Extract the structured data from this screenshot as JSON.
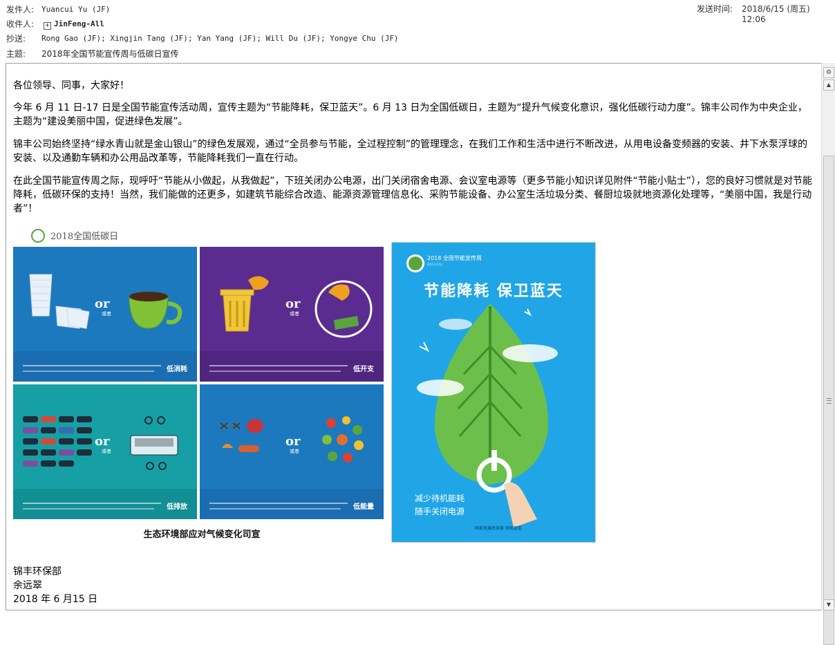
{
  "header": {
    "from_label": "发件人:",
    "from_value": "Yuancui Yu (JF)",
    "to_label": "收件人:",
    "to_value": "JinFeng-All",
    "to_icon": "group-expand-icon",
    "cc_label": "抄送:",
    "cc_value": "Rong Gao (JF); Xingjin Tang (JF); Yan Yang (JF); Will Du (JF); Yongye Chu (JF)",
    "subject_label": "主题:",
    "subject_value": "2018年全国节能宣传周与低碳日宣传",
    "sent_label": "发送时间:",
    "sent_value": "2018/6/15 (周五) 12:06"
  },
  "body": {
    "greeting": "各位领导、同事，大家好！",
    "p1": "今年 6 月 11 日-17 日是全国节能宣传活动周，宣传主题为“节能降耗，保卫蓝天”。6 月 13 日为全国低碳日，主题为“提升气候变化意识，强化低碳行动力度”。锦丰公司作为中央企业，主题为“建设美丽中国，促进绿色发展”。",
    "p2": "锦丰公司始终坚持“绿水青山就是金山银山”的绿色发展观，通过“全员参与节能，全过程控制”的管理理念，在我们工作和生活中进行不断改进，从用电设备变频器的安装、井下水泵浮球的安装、以及通勤车辆和办公用品改革等，节能降耗我们一直在行动。",
    "p3": "在此全国节能宣传周之际，现呼吁“节能从小做起，从我做起”，下班关闭办公电源，出门关闭宿舍电源、会议室电源等（更多节能小知识详见附件“节能小贴士”），您的良好习惯就是对节能降耗，低碳环保的支持！当然，我们能做的还更多，如建筑节能综合改造、能源资源管理信息化、采购节能设备、办公室生活垃圾分类、餐厨垃圾就地资源化处理等，“美丽中国，我是行动者”！"
  },
  "left_image": {
    "header_title": "2018全国低碳日",
    "cells": [
      {
        "or": "or",
        "huozhe": "或者",
        "tag": "低消耗",
        "bg": "#1d79be",
        "strip": "#1a6db0"
      },
      {
        "or": "or",
        "huozhe": "或者",
        "tag": "低开支",
        "bg": "#5b2c8f",
        "strip": "#4f2580"
      },
      {
        "or": "or",
        "huozhe": "或者",
        "tag": "低排放",
        "bg": "#16a0a6",
        "strip": "#128f95"
      },
      {
        "or": "or",
        "huozhe": "或者",
        "tag": "低能量",
        "bg": "#1d79be",
        "strip": "#1a6db0"
      }
    ],
    "footer": "生态环境部应对气候变化司宣"
  },
  "poster": {
    "small_title": "2018 全国节能宣传周",
    "date": "6月11-17日",
    "main_title": "节能降耗 保卫蓝天",
    "line1": "减少待机能耗",
    "line2": "随手关闭电源",
    "footer": "国家发展改革委 财政部宣"
  },
  "signature": {
    "dept": "锦丰环保部",
    "name": "余远翠",
    "date": "2018 年 6 月15 日"
  },
  "colors": {
    "poster_bg": "#20a6e6",
    "leaf": "#6cbf4a"
  }
}
